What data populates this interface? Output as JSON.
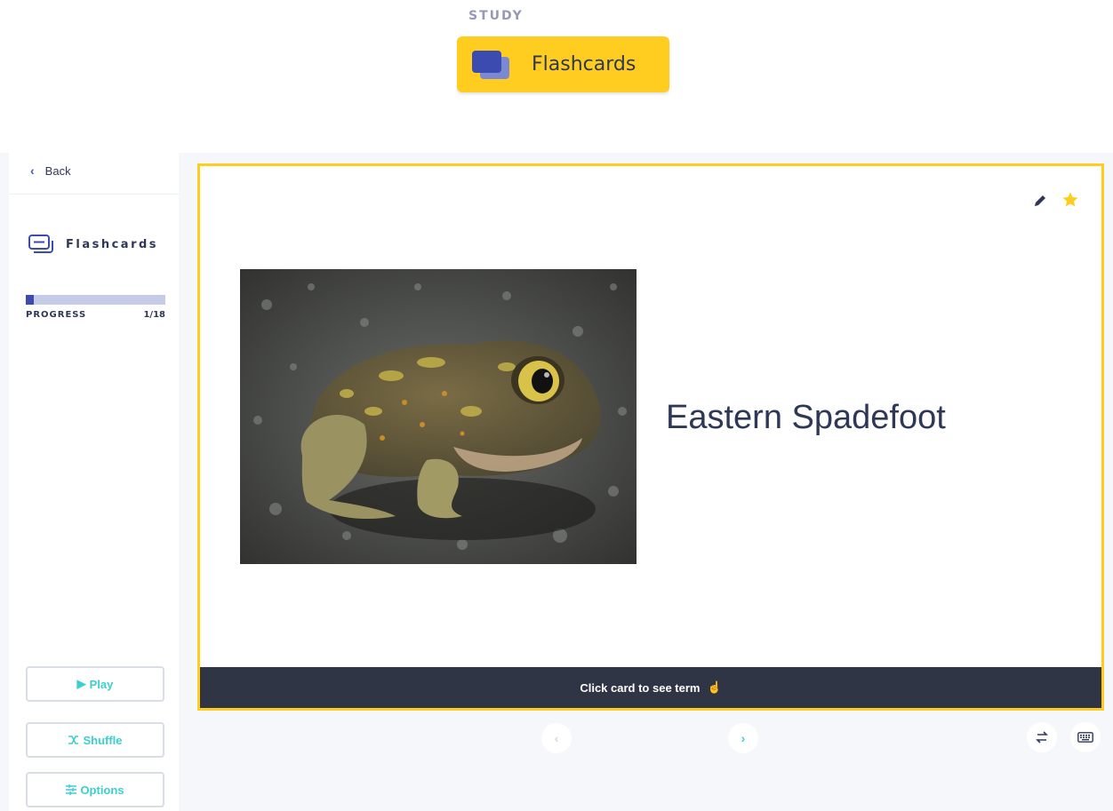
{
  "header": {
    "study_label": "STUDY",
    "mode_button": "Flashcards"
  },
  "sidebar": {
    "back_label": "Back",
    "title": "Flashcards",
    "progress_label": "PROGRESS",
    "progress_count": "1/18",
    "progress_fraction": 0.0556,
    "buttons": {
      "play": "Play",
      "shuffle": "Shuffle",
      "options": "Options"
    }
  },
  "card": {
    "term": "Eastern Spadefoot",
    "hint": "Click card to see term"
  },
  "icons": {
    "edit": "pencil-icon",
    "star": "star-icon",
    "prev": "chevron-left-icon",
    "next": "chevron-right-icon",
    "swap": "swap-icon",
    "keyboard": "keyboard-icon"
  },
  "colors": {
    "accent_yellow": "#ffcd1f",
    "brand_blue": "#3b4bb0",
    "teal": "#3ccfcf",
    "dark": "#303545",
    "text": "#2e3856"
  }
}
